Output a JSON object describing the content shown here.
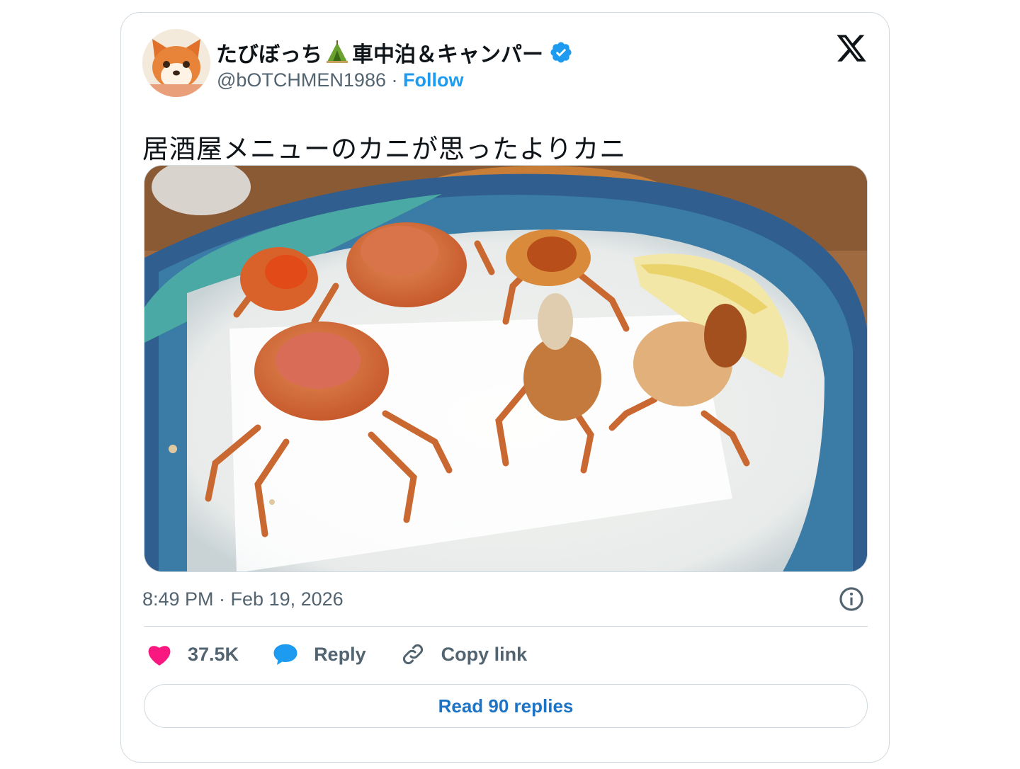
{
  "author": {
    "display_name_a": "たびぼっち",
    "display_name_b": "車中泊＆キャンパー",
    "handle": "@bOTCHMEN1986",
    "separator": "·",
    "follow_label": "Follow",
    "avatar_icon": "dog-avatar",
    "verified_icon": "verified-badge-icon"
  },
  "tweet": {
    "text": "居酒屋メニューのカニが思ったよりカニ",
    "media_icon": "fried-crabs-photo",
    "timestamp": "8:49 PM · Feb 19, 2026"
  },
  "actions": {
    "likes": "37.5K",
    "reply_label": "Reply",
    "copy_label": "Copy link"
  },
  "read_replies_label": "Read 90 replies",
  "colors": {
    "accent": "#1d9bf0",
    "like": "#f91880",
    "muted": "#536471",
    "border": "#cfd9de"
  }
}
